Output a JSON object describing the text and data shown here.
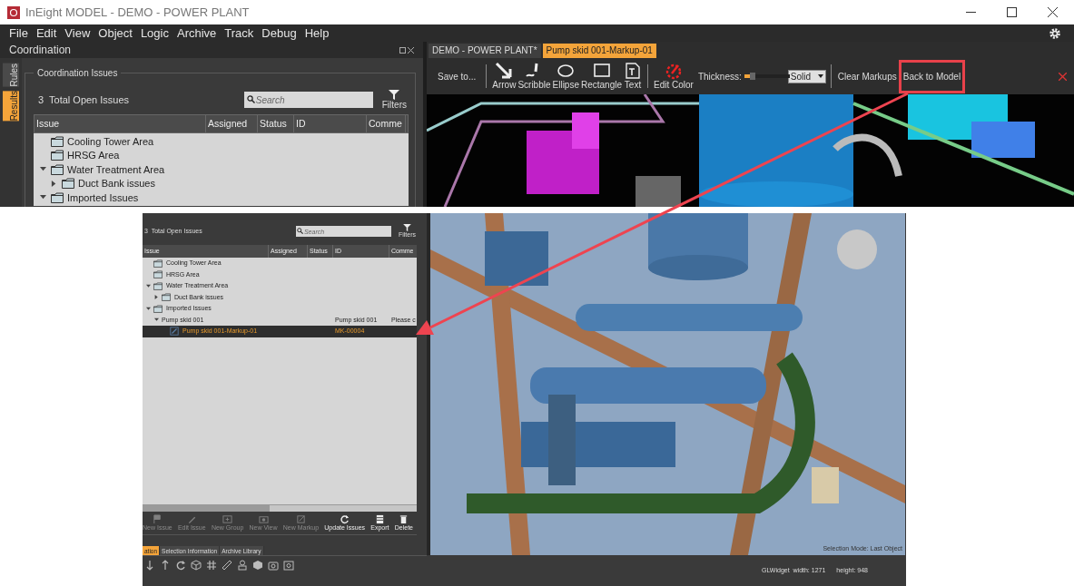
{
  "window": {
    "title": "InEight MODEL - DEMO - POWER PLANT"
  },
  "menu": [
    "File",
    "Edit",
    "View",
    "Object",
    "Logic",
    "Archive",
    "Track",
    "Debug",
    "Help"
  ],
  "coordination": {
    "title": "Coordination",
    "side_tabs": [
      {
        "label": "Rules",
        "selected": false
      },
      {
        "label": "Results",
        "selected": true
      }
    ],
    "group_title": "Coordination Issues",
    "total": "3  Total Open Issues",
    "search": {
      "placeholder": "Search"
    },
    "filters": "Filters",
    "columns": [
      "Issue",
      "Assigned",
      "Status",
      "ID",
      "Comme"
    ],
    "tree": [
      {
        "label": "Cooling Tower Area",
        "kind": "folder"
      },
      {
        "label": "HRSG Area",
        "kind": "folder"
      },
      {
        "label": "Water Treatment Area",
        "kind": "folder",
        "expanded": true,
        "children": [
          {
            "label": "Duct Bank issues",
            "kind": "folder",
            "expanded": false
          }
        ]
      },
      {
        "label": "Imported Issues",
        "kind": "folder",
        "expanded": true
      }
    ]
  },
  "document_tabs": [
    {
      "label": "DEMO - POWER PLANT*",
      "selected": false
    },
    {
      "label": "Pump skid 001-Markup-01",
      "selected": true
    }
  ],
  "markup_toolbar": {
    "save": "Save to...",
    "tools": [
      {
        "label": "Arrow",
        "kind": "arrow"
      },
      {
        "label": "Scribble",
        "kind": "scribble"
      },
      {
        "label": "Ellipse",
        "kind": "ellipse"
      },
      {
        "label": "Rectangle",
        "kind": "rectangle"
      },
      {
        "label": "Text",
        "kind": "text"
      },
      {
        "label": "Edit Color",
        "kind": "color"
      }
    ],
    "thickness": {
      "label": "Thickness:",
      "level": 0.12
    },
    "line_style": "Solid",
    "clear": "Clear Markups",
    "back": "Back to Model"
  },
  "inset": {
    "total": "3  Total Open Issues",
    "search": {
      "placeholder": "Search"
    },
    "filters": "Filters",
    "columns": [
      "Issue",
      "Assigned",
      "Status",
      "ID",
      "Comme"
    ],
    "tree": [
      {
        "label": "Cooling Tower Area",
        "kind": "folder",
        "selected": false
      },
      {
        "label": "HRSG Area",
        "kind": "folder",
        "selected": false
      },
      {
        "label": "Water Treatment Area",
        "kind": "folder",
        "selected": false,
        "expanded": true,
        "children": [
          {
            "label": "Duct Bank issues",
            "kind": "folder",
            "selected": false,
            "expanded": false
          }
        ]
      },
      {
        "label": "Imported Issues",
        "kind": "folder",
        "selected": false,
        "expanded": true,
        "children": [
          {
            "label": "Pump skid 001",
            "kind": "group",
            "selected": false,
            "expanded": true,
            "id": "Pump skid 001",
            "comment": "Please c",
            "children": [
              {
                "label": "Pump skid 001-Markup-01",
                "kind": "markup",
                "selected": true,
                "id": "MK-00004"
              }
            ]
          }
        ]
      }
    ],
    "actions": [
      {
        "label": "New Issue",
        "kind": "flag",
        "disabled": true
      },
      {
        "label": "Edit Issue",
        "kind": "pencil",
        "disabled": true
      },
      {
        "label": "New Group",
        "kind": "folder",
        "disabled": true
      },
      {
        "label": "New View",
        "kind": "camera",
        "disabled": true
      },
      {
        "label": "New Markup",
        "kind": "markup",
        "disabled": true
      },
      {
        "label": "Update Issues",
        "kind": "refresh",
        "disabled": false
      },
      {
        "label": "Export",
        "kind": "sheet",
        "disabled": false
      },
      {
        "label": "Delete",
        "kind": "trash",
        "disabled": false
      }
    ],
    "bottom_tabs": [
      {
        "label": "ation",
        "selected": true
      },
      {
        "label": "Selection Information",
        "selected": false
      },
      {
        "label": "Archive Library",
        "selected": false
      }
    ],
    "selection_mode": "Selection Mode: Last Object",
    "status": [
      "GLWidget  width: 1271",
      "height: 948"
    ]
  }
}
